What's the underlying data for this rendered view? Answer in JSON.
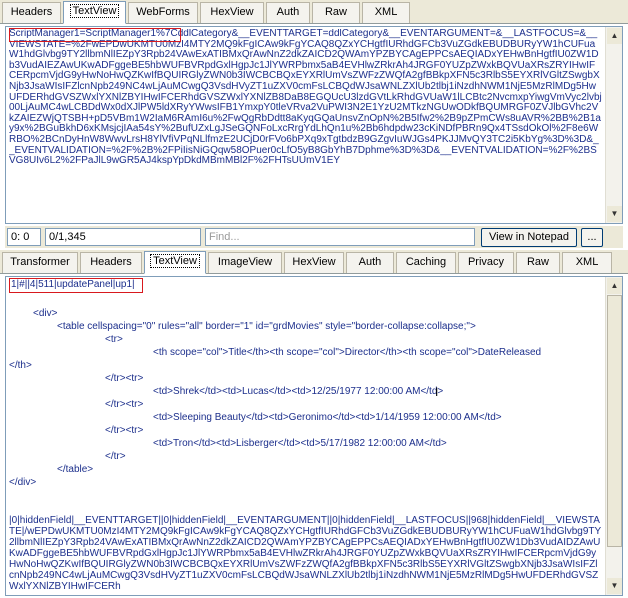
{
  "request_tabs": [
    {
      "label": "Headers",
      "active": false
    },
    {
      "label": "TextView",
      "active": true
    },
    {
      "label": "WebForms",
      "active": false
    },
    {
      "label": "HexView",
      "active": false
    },
    {
      "label": "Auth",
      "active": false
    },
    {
      "label": "Raw",
      "active": false
    },
    {
      "label": "XML",
      "active": false
    }
  ],
  "request_text": {
    "highlight": "ScriptManager1=ScriptManager1%",
    "body": "7CddlCategory&__EVENTTARGET=ddlCategory&__EVENTARGUMENT=&__LASTFOCUS=&__VIEWSTATE=%2FwEPDwUKMTU0MzI4MTY2MQ9kFgICAw9kFgYCAQ8QZxYCHgtfIURhdGFCb3VuZGdkEBUDBURyYW1hCUFuaW1hdGlvbg9TY2llbmNlIEZpY3Rpb24VAwExATIBMxQrAwNnZ2dkZAICD2QWAmYPZBYCAgEPPCsAEQIADxYEHwBnHgtfIU0ZW1Db3VudAIEZAwUKwADFggeBE5hbWUFBVRpdGxlHgpJc1JlYWRPbmx5aB4EVHlwZRkrAh4JRGF0YUZpZWxkBQVUaXRsZRYIHwIFCERpcmVjdG9yHwNoHwQZKwIfBQUIRGlyZWN0b3IWCBCBQxEYXRlUmVsZWFzZWQfA2gfBBkpXFN5c3RlbS5EYXRlVGltZSwgbXNjb3JsaWIsIFZlcnNpb249NC4wLjAuMCwgQ3VsdHVyZT1uZXV0cmFsLCBQdWJsaWNLZXlUb2tlbj1iNzdhNWM1NjE5MzRlMDg5HwUFDERhdGVSZWxlYXNlZBYIHwIFCERhdGVSZWxlYXNlZB8DaB8EGQUcU3lzdGVtLkRhdGVUaW1lLCBtc2NvcmxpYiwgVmVyc2lvbj00LjAuMC4wLCBDdWx0dXJlPW5ldXRyYWwsIFB1YmxpY0tleVRva2VuPWI3N2E1YzU2MTkzNGUwODkfBQUMRGF0ZVJlbGVhc2VkZAIEZWjQTSBH+pD5VBm1W2IaM6RAmI6u%2FwQgRbDdtt8aKyqGQaUnsvZnOpN%2B5Ifw2%2B9pZPmCWs8uAVR%2BB%2B1ay9x%2BGuBkhD6xKMsjcjIAa54sY%2BufUZxLgJSeGQNFoLxcRrgYdLhQn1u%2Bb6hdpdw23cKiNDfPBRn9Qx4TSsdOkOl%2F8e6WRBO%2BCnDyHnW8WwvLrsH8YlVfiVPqNLlfmzE2UCjD0rFVo6bPXq9xTgtbdzB9GZgvIuWJGs4PKJJMvQY3TC2i5KbYg%3D%3D&__EVENTVALIDATION=%2F%2B%2FPiIisNiGQqw58OPuer0cLfO5yB8GbYhB7Dphme%3D%3D&__EVENTVALIDATION=%2F%2BSVG8UIv6L2%2FPaJlL9wGR5AJ4kspYpDkdMBmMBl2F%2FHTsUUmV1EY"
  },
  "status": {
    "position": "0: 0",
    "count": "0/1,345",
    "find_placeholder": "Find...",
    "view_button": "View in Notepad",
    "more_button": "..."
  },
  "response_tabs": [
    {
      "label": "Transformer",
      "active": false
    },
    {
      "label": "Headers",
      "active": false
    },
    {
      "label": "TextView",
      "active": true
    },
    {
      "label": "ImageView",
      "active": false
    },
    {
      "label": "HexView",
      "active": false
    },
    {
      "label": "Auth",
      "active": false
    },
    {
      "label": "Caching",
      "active": false
    },
    {
      "label": "Privacy",
      "active": false
    },
    {
      "label": "Raw",
      "active": false
    },
    {
      "label": "XML",
      "active": false
    }
  ],
  "response_text": {
    "highlight": "1|#||4|511|updatePanel|up1|",
    "lines": [
      "<div>",
      "<table cellspacing=\"0\" rules=\"all\" border=\"1\" id=\"grdMovies\" style=\"border-collapse:collapse;\">",
      "<tr>",
      "<th scope=\"col\">Title</th><th scope=\"col\">Director</th><th scope=\"col\">DateReleased",
      "</th>",
      "</tr><tr>",
      "<td>Shrek</td><td>Lucas</td><td>12/25/1977 12:00:00 AM</td>",
      "</tr><tr>",
      "<td>Sleeping Beauty</td><td>Geronimo</td><td>1/14/1959 12:00:00 AM</td>",
      "</tr><tr>",
      "<td>Tron</td><td>Lisberger</td><td>5/17/1982 12:00:00 AM</td>",
      "</tr>",
      "</table>",
      "</div>"
    ],
    "tail": "|0|hiddenField|__EVENTTARGET||0|hiddenField|__EVENTARGUMENT||0|hiddenField|__LASTFOCUS||968|hiddenField|__VIEWSTATE|/wEPDwUKMTU0MzI4MTY2MQ9kFgICAw9kFgYCAQ8QZxYCHgtfIURhdGFCb3VuZGdkEBUDBURyYW1hCUFuaW1hdGlvbg9TY2llbmNlIEZpY3Rpb24VAwExATIBMxQrAwNnZ2dkZAICD2QWAmYPZBYCAgEPPCsAEQIADxYEHwBnHgtfIU0ZW1Db3VudAIDZAwUKwADFggeBE5hbWUFBVRpdGxlHgpJc1JlYWRPbmx5aB4EVHlwZRkrAh4JRGF0YUZpZWxkBQVUaXRsZRYIHwIFCERpcmVjdG9yHwNoHwQZKwIfBQUIRGlyZWN0b3IWCBCBQxEYXRlUmVsZWFzZWQfA2gfBBkpXFN5c3RlbS5EYXRlVGltZSwgbXNjb3JsaWIsIFZlcnNpb249NC4wLjAuMCwgQ3VsdHVyZT1uZXV0cmFsLCBQdWJsaWNLZXlUb2tlbj1iNzdhNWM1NjE5MzRlMDg5HwUFDERhdGVSZWxlYXNlZBYIHwIFCERh"
  }
}
